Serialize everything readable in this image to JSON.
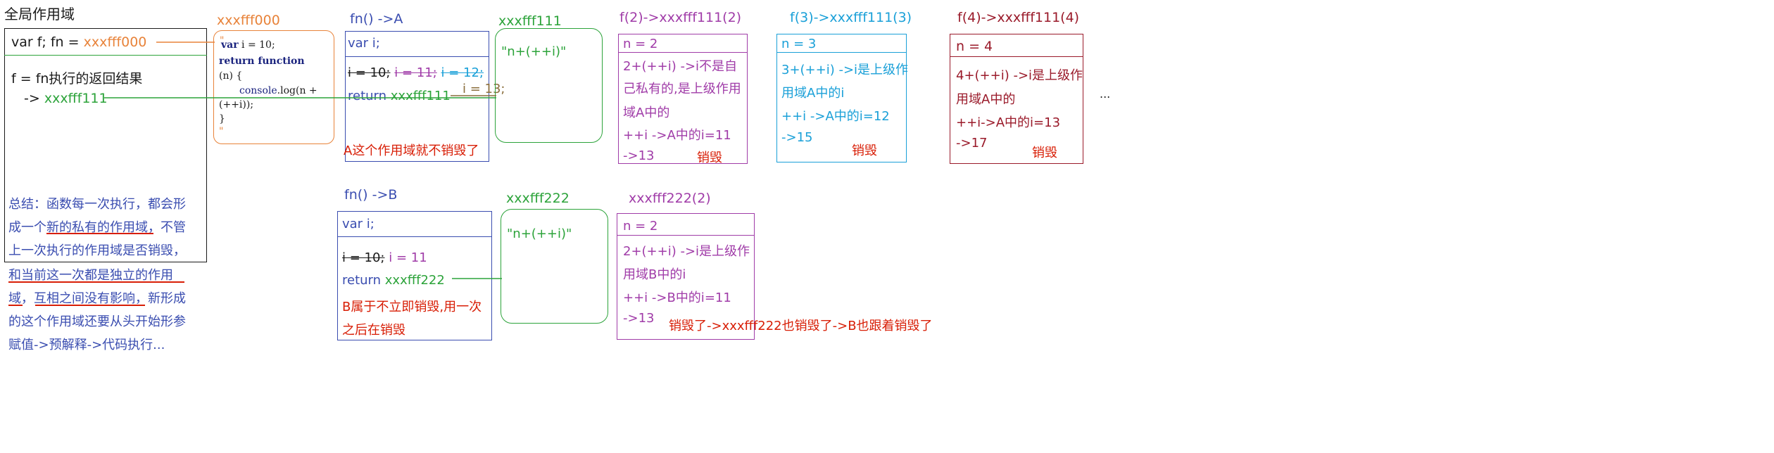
{
  "colors": {
    "black": "#1a1a1a",
    "orange": "#e8833a",
    "green": "#2ca33a",
    "blue": "#3a4db0",
    "purple": "#a03ca8",
    "cyan": "#1aa0d8",
    "darkred": "#9a1a2a",
    "red": "#d81e06",
    "brown": "#8a6d3b",
    "navy": "#1a237e"
  },
  "global": {
    "title": "全局作用域",
    "var_line_prefix": "var f;  fn =",
    "var_line_ref": "xxxfff000",
    "f_line": "f = fn执行的返回结果",
    "arrow_prefix": "->",
    "arrow_ref": "xxxfff111",
    "summary_1": "总结：函数每一次执行，都会形",
    "summary_2a": "成一个",
    "summary_2b": "新的私有的作用域",
    "summary_2c": "，不管",
    "summary_3": "上一次执行的作用域是否销毁，",
    "summary_4": "和当前这一次都是独立的作用",
    "summary_5a": "域",
    "summary_5b": "，",
    "summary_5c": "互相之间没有影响",
    "summary_5d": "，新形成",
    "summary_6": "的这个作用域还要从头开始形参",
    "summary_7": "赋值->预解释->代码执行..."
  },
  "heap000": {
    "title": "xxxfff000",
    "q_open": "\"",
    "code_1a": "var",
    "code_1b": " i = 10;",
    "code_2": "return function",
    "code_3": "(n) {",
    "code_4a": "console",
    "code_4b": ".log(n +",
    "code_5": "(++i));",
    "code_6": "}",
    "q_close": "\""
  },
  "fnA": {
    "title": "fn()  ->A",
    "var_i": "var i;",
    "i10": "i = 10;",
    "i11": "i = 11;",
    "i12": "i = 12;",
    "i13": "i = 13;",
    "return_label": "return",
    "return_ref": "xxxfff111",
    "note": "A这个作用域就不销毁了"
  },
  "heap111": {
    "title": "xxxfff111",
    "content": "\"n+(++i)\""
  },
  "f2": {
    "title": "f(2)->xxxfff111(2)",
    "n": "n = 2",
    "l1": "2+(++i) ->i不是自",
    "l2": "己私有的,是上级作用",
    "l3": "域A中的",
    "l4": "++i ->A中的i=11",
    "l5": "->13",
    "destroy": "销毁"
  },
  "f3": {
    "title": "f(3)->xxxfff111(3)",
    "n": "n = 3",
    "l1": "3+(++i) ->i是上级作",
    "l2": "用域A中的i",
    "l3": "++i ->A中的i=12",
    "l4": "->15",
    "destroy": "销毁"
  },
  "f4": {
    "title": "f(4)->xxxfff111(4)",
    "n": "n = 4",
    "l1": "4+(++i) ->i是上级作",
    "l2": "用域A中的",
    "l3": "++i->A中的i=13",
    "l4": "->17",
    "destroy": "销毁"
  },
  "ellipsis": "...",
  "fnB": {
    "title": "fn() ->B",
    "var_i": "var i;",
    "i10": "i = 10;",
    "i11": "i = 11",
    "return_label": "return",
    "return_ref": "xxxfff222",
    "note_1": "B属于不立即销毁,用一次",
    "note_2": "之后在销毁"
  },
  "heap222": {
    "title": "xxxfff222",
    "content": "\"n+(++i)\""
  },
  "f222": {
    "title": "xxxfff222(2)",
    "n": "n = 2",
    "l1": "2+(++i) ->i是上级作",
    "l2": "用域B中的i",
    "l3": "++i ->B中的i=11",
    "l4": "->13",
    "destroy_note": "销毁了->xxxfff222也销毁了->B也跟着销毁了"
  }
}
